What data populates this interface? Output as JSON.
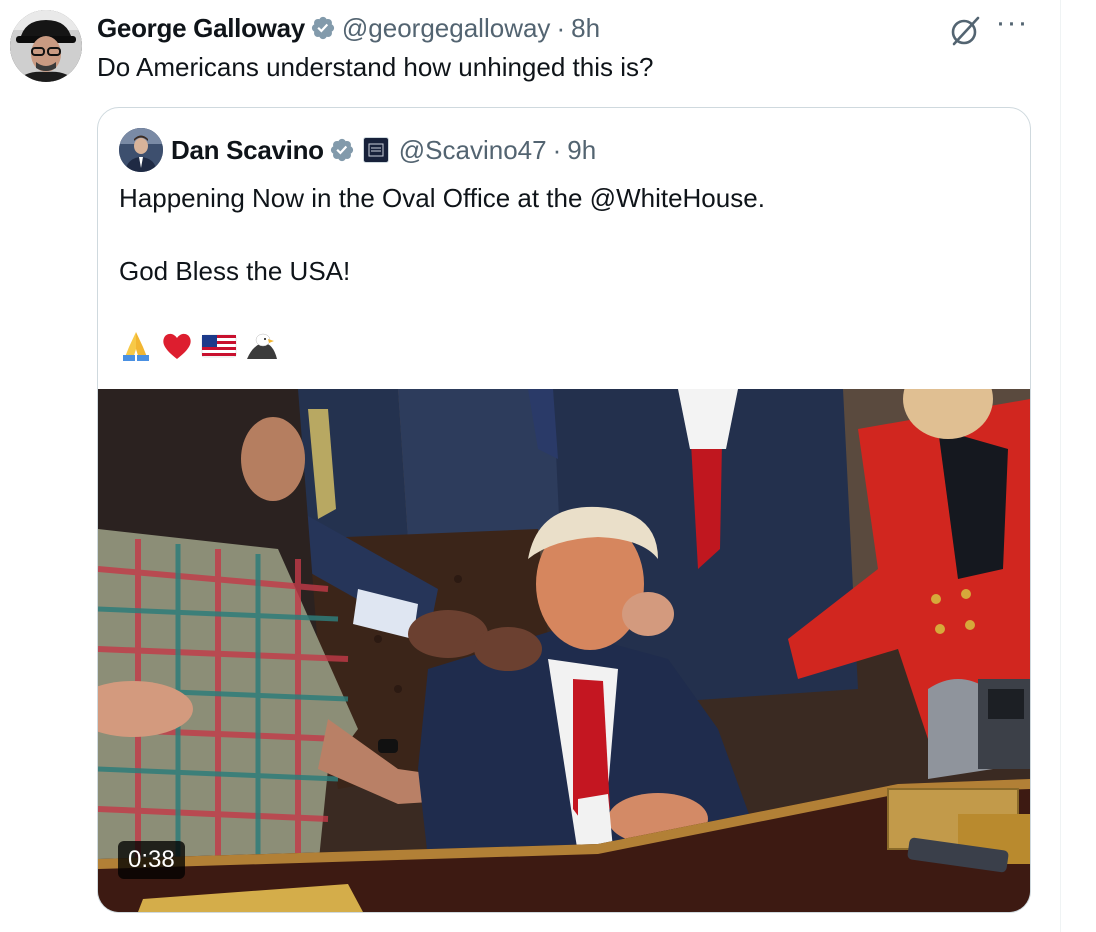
{
  "author": {
    "name": "George Galloway",
    "handle": "@georgegalloway",
    "separator": "·",
    "time": "8h",
    "verified": true
  },
  "post_text": "Do Americans understand how unhinged this is?",
  "quoted": {
    "name": "Dan Scavino",
    "handle": "@Scavino47",
    "separator": "·",
    "time": "9h",
    "verified": true,
    "lines": [
      "Happening Now in the Oval Office at the @WhiteHouse.",
      "God Bless the USA!"
    ],
    "emojis": [
      "folded-hands",
      "red-heart",
      "us-flag",
      "eagle"
    ],
    "video_duration": "0:38"
  },
  "icons": [
    "verified-badge-icon",
    "grok-icon",
    "more-options-icon",
    "affiliate-badge-icon",
    "play-duration-badge"
  ],
  "colors": {
    "text_primary": "#0f1419",
    "text_secondary": "#536471",
    "verified_badge": "#829aab",
    "card_border": "#cfd9de",
    "red_suit": "#d1261f"
  }
}
